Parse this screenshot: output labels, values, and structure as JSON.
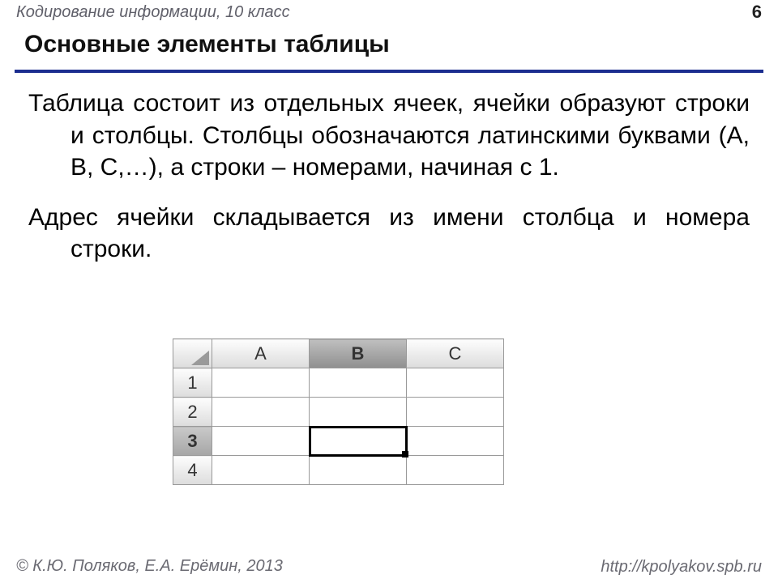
{
  "header": {
    "course": "Кодирование информации, 10 класс",
    "page": "6"
  },
  "title": "Основные элементы таблицы",
  "paragraphs": {
    "p1": "Таблица состоит из отдельных ячеек, ячейки образуют строки и столбцы. Столбцы обозначаются латинскими буквами (A, B, C,…), а строки – номерами, начиная с 1.",
    "p2": "Адрес ячейки складывается из имени столбца и номера строки."
  },
  "sheet": {
    "cols": {
      "A": "A",
      "B": "B",
      "C": "C"
    },
    "rows": {
      "1": "1",
      "2": "2",
      "3": "3",
      "4": "4"
    },
    "selected_col": "B",
    "selected_row": "3",
    "active_cell": "B3"
  },
  "footer": {
    "author": "© К.Ю. Поляков, Е.А. Ерёмин, 2013",
    "url": "http://kpolyakov.spb.ru"
  }
}
